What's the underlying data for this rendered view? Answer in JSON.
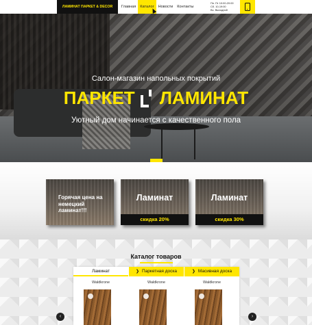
{
  "header": {
    "logo": "ЛАМИНАТ ПАРКЕТ & DECOR",
    "nav": [
      "Главная",
      "Каталог",
      "Новости",
      "Контакты"
    ],
    "active_nav": "Каталог",
    "hours": [
      "Пн. Пт 10:00-20:00",
      "Сб. 10-19:00",
      "Вс. Выходной"
    ],
    "phone_icon": "phone-icon"
  },
  "hero": {
    "subtitle": "Салон-магазин напольных покрытий",
    "title_left": "ПАРКЕТ",
    "title_right": "ЛАМИНАТ",
    "tagline": "Уютный дом начинается с качественного пола",
    "plus_label": "+"
  },
  "promos": [
    {
      "text": "Горячая цена на немецкий ламинат!!!"
    },
    {
      "title": "Ламинат",
      "badge": "скидка 20%"
    },
    {
      "title": "Ламинат",
      "badge": "скидка 30%"
    }
  ],
  "catalog": {
    "title": "Каталог товаров",
    "tabs": [
      "Ламинат",
      "Паркетная доска",
      "Масивная доска"
    ],
    "products": [
      {
        "brand": "Waldkrone"
      },
      {
        "brand": "Waldkrone"
      },
      {
        "brand": "Waldkrone"
      }
    ],
    "prev_icon": "chevron-left-icon",
    "next_icon": "chevron-right-icon"
  },
  "colors": {
    "accent": "#ffe600",
    "dark": "#111111"
  }
}
